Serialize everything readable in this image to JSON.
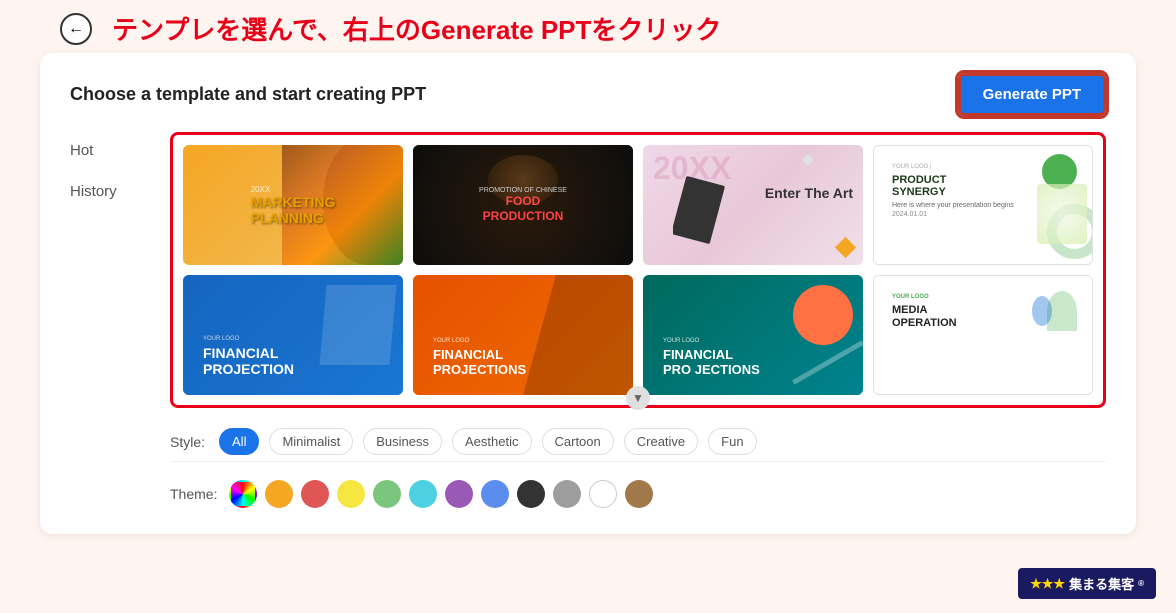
{
  "annotation": {
    "text": "テンプレを選んで、右上のGenerate PPTをクリック"
  },
  "back_button": {
    "label": "←"
  },
  "header": {
    "title": "Choose a template and start creating PPT",
    "generate_btn": "Generate PPT"
  },
  "sidebar": {
    "items": [
      {
        "id": "hot",
        "label": "Hot",
        "active": false
      },
      {
        "id": "history",
        "label": "History",
        "active": false
      }
    ]
  },
  "templates": [
    {
      "id": "tmpl1",
      "label_small": "20XX",
      "label_big": "MARKETING\nPLANNING",
      "theme": "orange-food"
    },
    {
      "id": "tmpl2",
      "label_top": "PROMOTION OF CHINESE",
      "label_main": "FOOD\nPRODUCTION",
      "theme": "dark-food"
    },
    {
      "id": "tmpl3",
      "label_year": "20XX",
      "label_main": "Enter The Art",
      "theme": "pink-art"
    },
    {
      "id": "tmpl4",
      "label_logo": "YOUR LOGO",
      "label_main": "PRODUCT SYNERGY",
      "theme": "white-green"
    },
    {
      "id": "tmpl5",
      "label_logo": "YOUR LOGO",
      "label_main": "FINANCIAL\nPROJECTION",
      "theme": "blue"
    },
    {
      "id": "tmpl6",
      "label_logo": "YOUR LOGO",
      "label_main": "FINANCIAL\nPROJECTIONS",
      "theme": "orange"
    },
    {
      "id": "tmpl7",
      "label_logo": "YOUR LOGO",
      "label_main": "FINANCIAL\nPROJECTIONS",
      "theme": "teal"
    },
    {
      "id": "tmpl8",
      "label_logo": "YOUR LOGO",
      "label_main": "MEDIA\nOPERATION",
      "theme": "white-illustration"
    }
  ],
  "style_filter": {
    "label": "Style:",
    "options": [
      {
        "id": "all",
        "label": "All",
        "active": true
      },
      {
        "id": "minimalist",
        "label": "Minimalist",
        "active": false
      },
      {
        "id": "business",
        "label": "Business",
        "active": false
      },
      {
        "id": "aesthetic",
        "label": "Aesthetic",
        "active": false
      },
      {
        "id": "cartoon",
        "label": "Cartoon",
        "active": false
      },
      {
        "id": "creative",
        "label": "Creative",
        "active": false
      },
      {
        "id": "fun",
        "label": "Fun",
        "active": false
      }
    ]
  },
  "theme_filter": {
    "label": "Theme:",
    "colors": [
      "rainbow",
      "#F5A623",
      "#E05555",
      "#F5E642",
      "#7BC67E",
      "#4DD0E1",
      "#9B59B6",
      "#5B8DEF",
      "#333333",
      "#9E9E9E",
      "#FFFFFF",
      "#A0784A"
    ]
  },
  "bottom_logo": {
    "text": "集まる集客",
    "stars": "★★★"
  },
  "scroll_down": "▼"
}
